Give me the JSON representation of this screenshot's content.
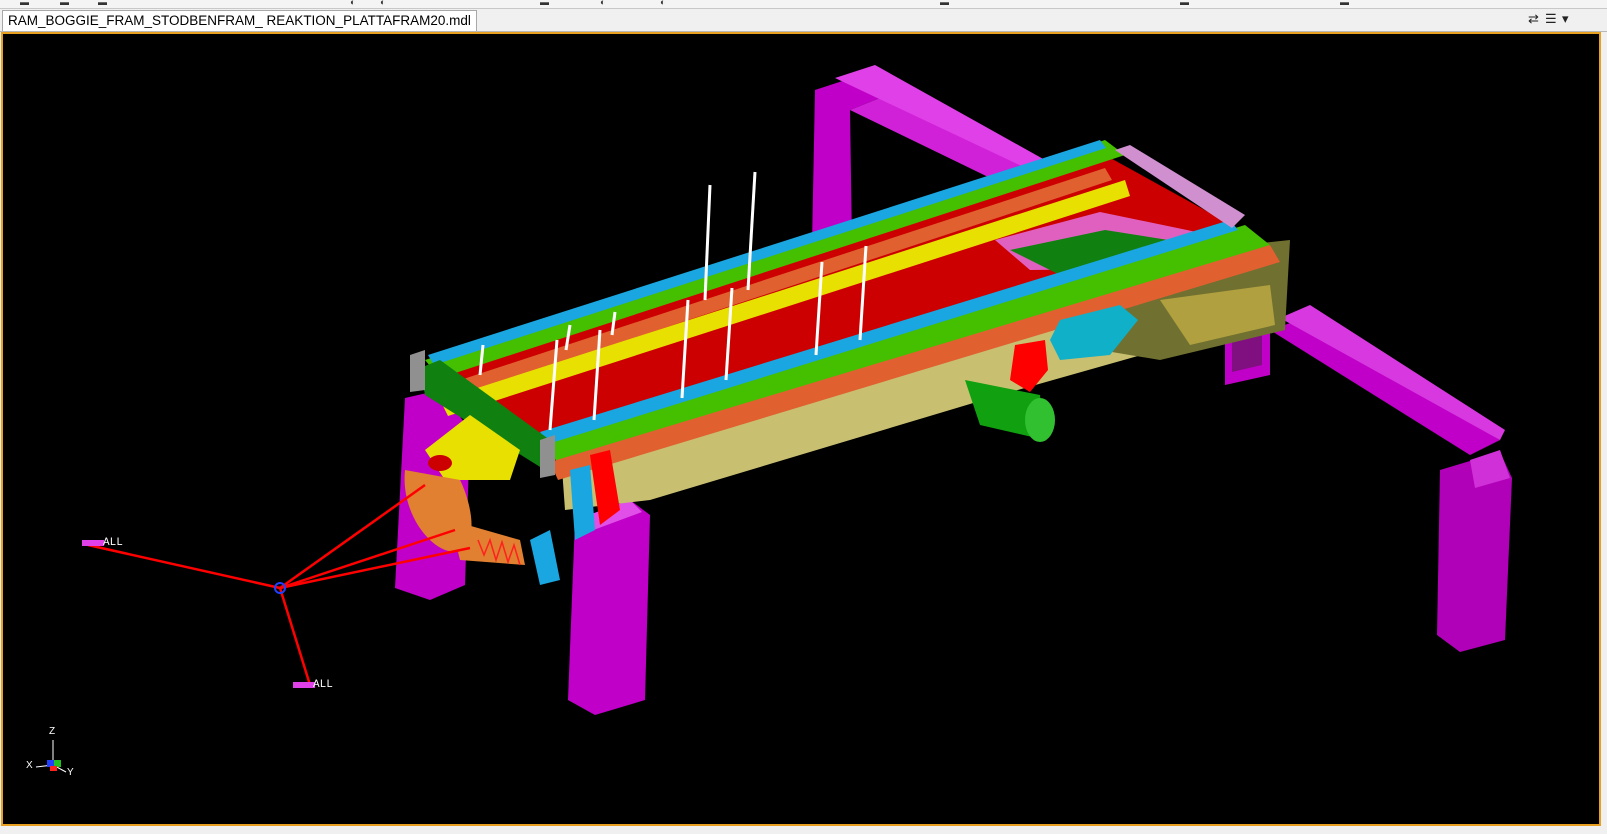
{
  "window": {
    "tab_title": "RAM_BOGGIE_FRAM_STODBENFRAM_ REAKTION_PLATTAFRAM20.mdl",
    "tab_controls": [
      "⇄",
      "☰",
      "▾"
    ]
  },
  "viewport": {
    "background": "#000000",
    "frame_color": "#e8a020",
    "markers": [
      {
        "label": "ALL"
      },
      {
        "label": "ALL"
      }
    ],
    "triad": {
      "x": "X",
      "y": "Y",
      "z": "Z"
    }
  },
  "colors": {
    "support_frame": "#c000c8",
    "rail_green": "#44c000",
    "rail_cyan": "#1aa6e0",
    "rail_yellow": "#e8e000",
    "rod_orange": "#e06030",
    "floor_red": "#cc0000",
    "side_khaki": "#c8c070",
    "force_lines": "#ff0000"
  }
}
